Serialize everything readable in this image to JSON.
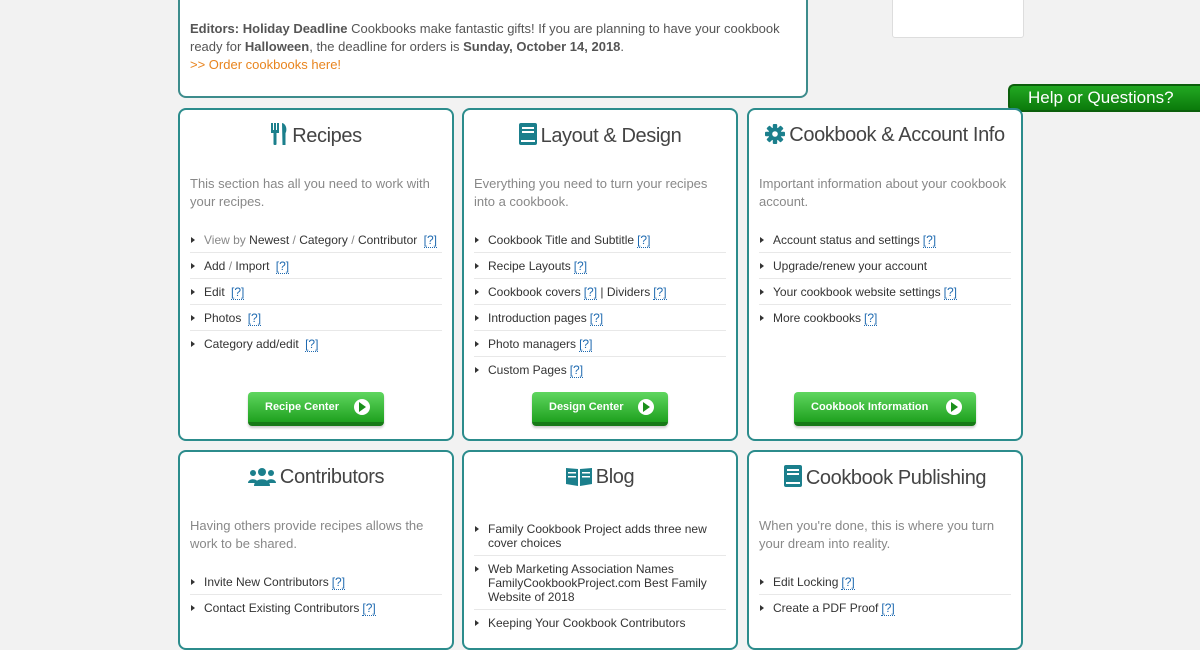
{
  "notice": {
    "label": "Editors:",
    "headline": "Holiday Deadline",
    "text1": " Cookbooks make fantastic gifts!  If you are planning to have your cookbook ready for ",
    "holiday": "Halloween",
    "text2": ", the deadline for orders is ",
    "date": "Sunday, October 14, 2018",
    "text3": ".",
    "link": ">> Order cookbooks here!"
  },
  "help_tab": "Help or Questions?",
  "help_mark": "[?]",
  "cards": {
    "recipes": {
      "title": "Recipes",
      "desc": "This section has all you need to work with your recipes.",
      "view_by": "View by",
      "newest": "Newest",
      "slash": "/",
      "category": "Category",
      "contributor": "Contributor",
      "add": "Add",
      "import": "Import",
      "edit": "Edit",
      "photos": "Photos",
      "category_add_edit": "Category add/edit",
      "button": "Recipe Center"
    },
    "layout": {
      "title": "Layout & Design",
      "desc": "Everything you need to turn your recipes into a cookbook.",
      "items": [
        "Cookbook Title and Subtitle",
        "Recipe Layouts",
        "Cookbook covers",
        "Introduction pages",
        "Photo managers",
        "Custom Pages"
      ],
      "dividers_sep": "|",
      "dividers": "Dividers",
      "button": "Design Center"
    },
    "account": {
      "title": "Cookbook & Account Info",
      "desc": "Important information about your cookbook account.",
      "items": [
        "Account status and settings",
        "Upgrade/renew your account",
        "Your cookbook website settings",
        "More cookbooks"
      ],
      "button": "Cookbook Information"
    },
    "contributors": {
      "title": "Contributors",
      "desc": "Having others provide recipes allows the work to be shared.",
      "items": [
        "Invite New Contributors",
        "Contact Existing Contributors"
      ]
    },
    "blog": {
      "title": "Blog",
      "items": [
        "Family Cookbook Project adds three new cover choices",
        "Web Marketing Association Names FamilyCookbookProject.com Best Family Website of 2018",
        "Keeping Your Cookbook Contributors"
      ]
    },
    "publishing": {
      "title": "Cookbook Publishing",
      "desc": "When you're done, this is where you turn your dream into reality.",
      "items": [
        "Edit Locking",
        "Create a PDF Proof"
      ]
    }
  },
  "colors": {
    "teal": "#2c8c8c",
    "green": "#1fa11f",
    "orange": "#e8841e",
    "link_blue": "#1f6ab0"
  }
}
